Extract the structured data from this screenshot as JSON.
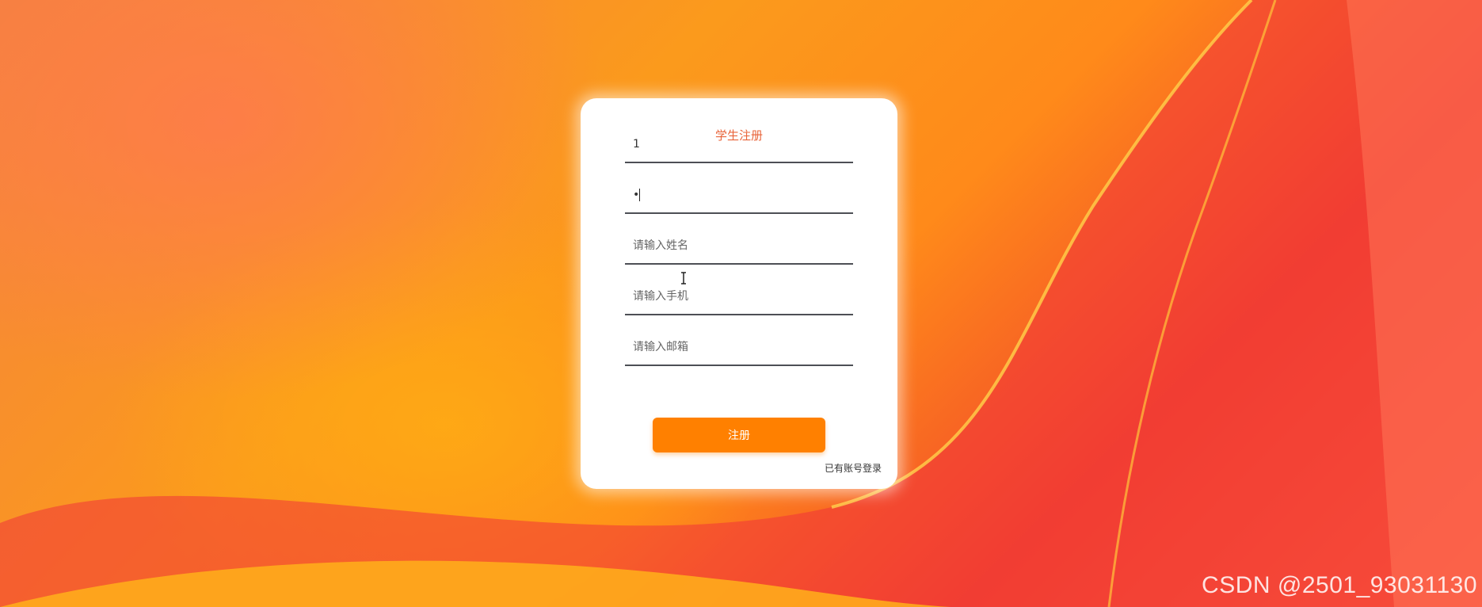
{
  "form": {
    "title": "学生注册",
    "fields": [
      {
        "name": "username",
        "value": "1",
        "placeholder": ""
      },
      {
        "name": "password",
        "value": "•",
        "placeholder": ""
      },
      {
        "name": "real_name",
        "value": "",
        "placeholder": "请输入姓名"
      },
      {
        "name": "phone",
        "value": "",
        "placeholder": "请输入手机"
      },
      {
        "name": "email",
        "value": "",
        "placeholder": "请输入邮箱"
      }
    ],
    "submit_label": "注册",
    "login_link": "已有账号登录"
  },
  "watermark": "CSDN @2501_93031130",
  "colors": {
    "accent": "#ff8000",
    "title": "#e8643a",
    "underline": "#4d4f55"
  }
}
